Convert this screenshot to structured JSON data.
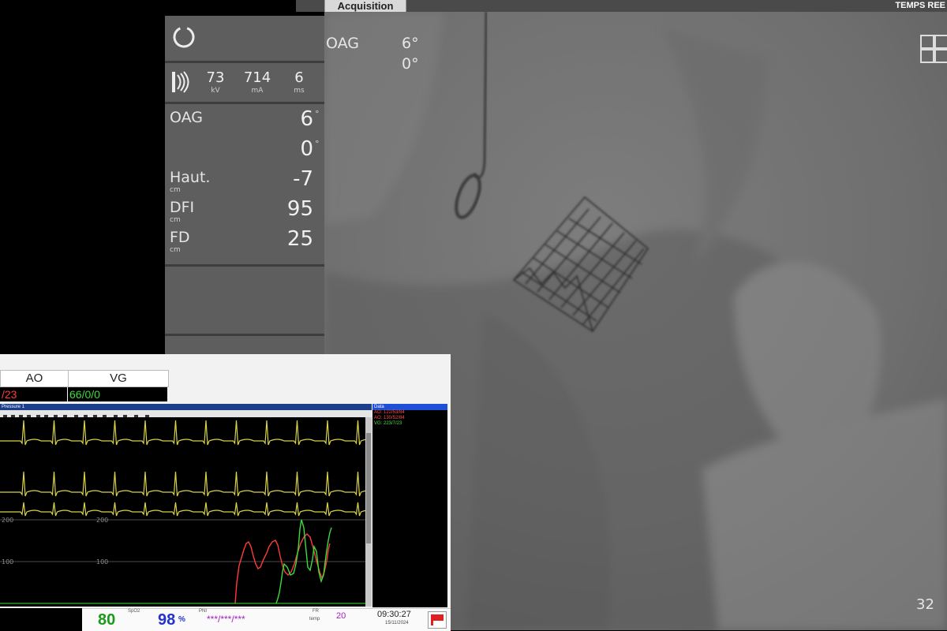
{
  "topbar": {
    "tab_label": "Acquisition",
    "right_label": "TEMPS REE"
  },
  "image": {
    "projection_label": "OAG",
    "angle1": "6°",
    "angle2": "0°",
    "frame_number": "32"
  },
  "panel": {
    "exposure": [
      {
        "value": "73",
        "unit": "kV"
      },
      {
        "value": "714",
        "unit": "mA"
      },
      {
        "value": "6",
        "unit": "ms"
      }
    ],
    "geometry": [
      {
        "label": "OAG",
        "unit": "",
        "value": "6",
        "suffix": "°"
      },
      {
        "label": "",
        "unit": "",
        "value": "0",
        "suffix": "°"
      },
      {
        "label": "Haut.",
        "unit": "cm",
        "value": "-7",
        "suffix": ""
      },
      {
        "label": "DFI",
        "unit": "cm",
        "value": "95",
        "suffix": ""
      },
      {
        "label": "FD",
        "unit": "cm",
        "value": "25",
        "suffix": ""
      }
    ]
  },
  "monitor": {
    "channels": [
      {
        "name": "AO",
        "value": "/23",
        "color": "#ff3b3b"
      },
      {
        "name": "VG",
        "value": "66/0/0",
        "color": "#3cdc3c"
      }
    ],
    "toolbar_title": "Pressure 1",
    "scale_labels": [
      "200",
      "200",
      "100",
      "100"
    ],
    "side_list": {
      "header": "Data",
      "lines": [
        {
          "text": "AO: 122/53/84",
          "color": "#ff4a4a"
        },
        {
          "text": "AO: 130/52/84",
          "color": "#ff4a4a"
        },
        {
          "text": "VG: 223/7/23",
          "color": "#46e046"
        }
      ]
    },
    "bottom": {
      "hr": "80",
      "spo2": "98",
      "spo2_unit": "%",
      "spo2_label": "SpO2",
      "nibp_label": "PNI",
      "nibp": "***/***/***",
      "fr_label": "FR",
      "fr": "20",
      "temp_label": "temp",
      "time": "09:30:27",
      "date": "15/11/2024"
    },
    "colors": {
      "ecg": "#d8d34a",
      "ao": "#ff3b3b",
      "vg": "#3cdc3c"
    }
  }
}
